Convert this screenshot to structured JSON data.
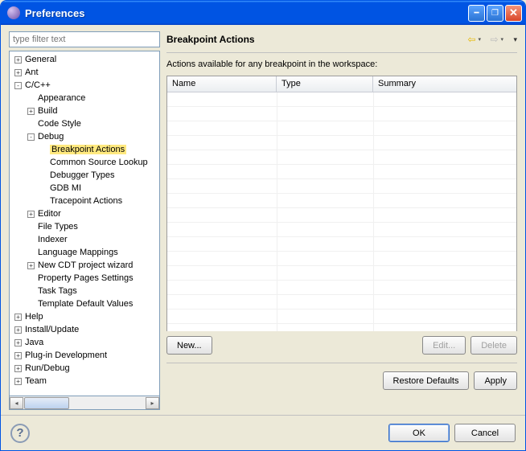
{
  "window": {
    "title": "Preferences"
  },
  "filter": {
    "placeholder": "type filter text"
  },
  "tree": [
    {
      "label": "General",
      "depth": 0,
      "twisty": "+"
    },
    {
      "label": "Ant",
      "depth": 0,
      "twisty": "+"
    },
    {
      "label": "C/C++",
      "depth": 0,
      "twisty": "-"
    },
    {
      "label": "Appearance",
      "depth": 1,
      "twisty": ""
    },
    {
      "label": "Build",
      "depth": 1,
      "twisty": "+"
    },
    {
      "label": "Code Style",
      "depth": 1,
      "twisty": ""
    },
    {
      "label": "Debug",
      "depth": 1,
      "twisty": "-"
    },
    {
      "label": "Breakpoint Actions",
      "depth": 2,
      "twisty": "",
      "highlighted": true
    },
    {
      "label": "Common Source Lookup",
      "depth": 2,
      "twisty": ""
    },
    {
      "label": "Debugger Types",
      "depth": 2,
      "twisty": ""
    },
    {
      "label": "GDB MI",
      "depth": 2,
      "twisty": ""
    },
    {
      "label": "Tracepoint Actions",
      "depth": 2,
      "twisty": ""
    },
    {
      "label": "Editor",
      "depth": 1,
      "twisty": "+"
    },
    {
      "label": "File Types",
      "depth": 1,
      "twisty": ""
    },
    {
      "label": "Indexer",
      "depth": 1,
      "twisty": ""
    },
    {
      "label": "Language Mappings",
      "depth": 1,
      "twisty": ""
    },
    {
      "label": "New CDT project wizard",
      "depth": 1,
      "twisty": "+"
    },
    {
      "label": "Property Pages Settings",
      "depth": 1,
      "twisty": ""
    },
    {
      "label": "Task Tags",
      "depth": 1,
      "twisty": ""
    },
    {
      "label": "Template Default Values",
      "depth": 1,
      "twisty": ""
    },
    {
      "label": "Help",
      "depth": 0,
      "twisty": "+"
    },
    {
      "label": "Install/Update",
      "depth": 0,
      "twisty": "+"
    },
    {
      "label": "Java",
      "depth": 0,
      "twisty": "+"
    },
    {
      "label": "Plug-in Development",
      "depth": 0,
      "twisty": "+"
    },
    {
      "label": "Run/Debug",
      "depth": 0,
      "twisty": "+"
    },
    {
      "label": "Team",
      "depth": 0,
      "twisty": "+"
    }
  ],
  "page": {
    "title": "Breakpoint Actions",
    "description": "Actions available for any breakpoint in the workspace:",
    "columns": {
      "name": "Name",
      "type": "Type",
      "summary": "Summary"
    },
    "rows": []
  },
  "buttons": {
    "new": "New...",
    "edit": "Edit...",
    "delete": "Delete",
    "restore": "Restore Defaults",
    "apply": "Apply",
    "ok": "OK",
    "cancel": "Cancel"
  }
}
